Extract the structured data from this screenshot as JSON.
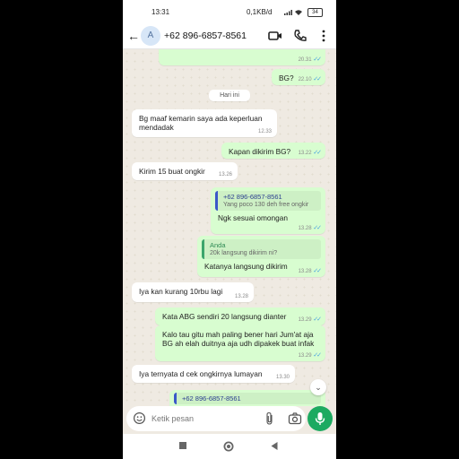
{
  "status": {
    "time": "13:31",
    "network": "0,1KB/d",
    "battery": "34"
  },
  "header": {
    "avatar_letter": "A",
    "contact": "+62 896-6857-8561",
    "icons": [
      "back-arrow-icon",
      "video-call-icon",
      "phone-call-icon",
      "more-vert-icon"
    ]
  },
  "day_divider": "Hari ini",
  "messages": [
    {
      "dir": "out",
      "text": "",
      "time": "20.31",
      "read": true
    },
    {
      "dir": "out",
      "text": "BG?",
      "time": "22.10",
      "read": true
    },
    {
      "dir": "in",
      "text": "Bg maaf kemarin saya ada keperluan\nmendadak",
      "time": "12.33"
    },
    {
      "dir": "out",
      "text": "Kapan dikirim BG?",
      "time": "13.22",
      "read": true
    },
    {
      "dir": "in",
      "text": "Kirim 15 buat ongkir",
      "time": "13.26"
    },
    {
      "dir": "out",
      "quote_name": "+62 896-6857-8561",
      "quote_text": "Yang poco 130 deh free ongkir",
      "text": "Ngk sesuai omongan",
      "time": "13.28",
      "read": true
    },
    {
      "dir": "out",
      "quote_name": "Anda",
      "quote_text": "20k langsung dikirim ni?",
      "text": "Katanya langsung dikirim",
      "time": "13.28",
      "read": true
    },
    {
      "dir": "in",
      "text": "Iya kan kurang 10rbu lagi",
      "time": "13.28"
    },
    {
      "dir": "out",
      "text": "Kata ABG sendiri 20 langsung dianter",
      "time": "13.29",
      "read": true
    },
    {
      "dir": "out",
      "text": "Kalo tau gitu mah paling bener hari Jum'at aja\nBG ah elah duitnya aja udh dipakek buat infak",
      "time": "13.29",
      "read": true
    },
    {
      "dir": "in",
      "text": "Iya ternyata d cek ongkirnya lumayan",
      "time": "13.30"
    },
    {
      "dir": "out",
      "quote_name": "+62 896-6857-8561",
      "text": "",
      "time": ""
    }
  ],
  "input": {
    "placeholder": "Ketik pesan"
  },
  "colors": {
    "incoming": "#ffffff",
    "outgoing": "#d8fdd0",
    "accent": "#1daa61",
    "read_tick": "#4aa3df",
    "chat_bg": "#efeae2"
  },
  "navbar": [
    "recents-square-icon",
    "home-circle-icon",
    "back-triangle-icon"
  ]
}
